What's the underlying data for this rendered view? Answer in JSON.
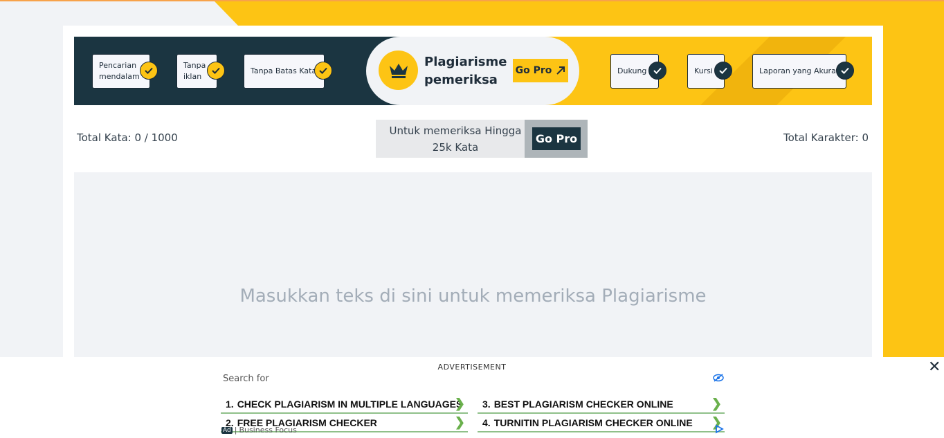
{
  "banner": {
    "features_left": [
      "Pencarian mendalam",
      "Tanpa iklan",
      "Tanpa Batas Kata"
    ],
    "brand_title": "Plagiarisme pemeriksa",
    "go_pro_label": "Go Pro",
    "features_right": [
      "Dukung",
      "Kursi",
      "Laporan yang Akurat"
    ]
  },
  "stats": {
    "total_words": "Total Kata: 0 / 1000",
    "total_chars": "Total Karakter: 0"
  },
  "promo": {
    "text": "Untuk memeriksa Hingga 25k Kata",
    "button": "Go Pro"
  },
  "editor": {
    "placeholder": "Masukkan teks di sini untuk memeriksa Plagiarisme"
  },
  "ad": {
    "label": "ADVERTISEMENT",
    "close": "✕",
    "search_for": "Search for",
    "links": [
      {
        "num": "1.",
        "text": "CHECK PLAGIARISM IN MULTIPLE LANGUAGES"
      },
      {
        "num": "2.",
        "text": "FREE PLAGIARISM CHECKER"
      },
      {
        "num": "3.",
        "text": "BEST PLAGIARISM CHECKER ONLINE"
      },
      {
        "num": "4.",
        "text": "TURNITIN PLAGIARISM CHECKER ONLINE"
      }
    ],
    "ad_tag": "Ad",
    "sponsor": "Business Focus"
  },
  "colors": {
    "navy": "#1b3541",
    "yellow": "#fdc414",
    "editor_bg": "#f1f3f6"
  }
}
